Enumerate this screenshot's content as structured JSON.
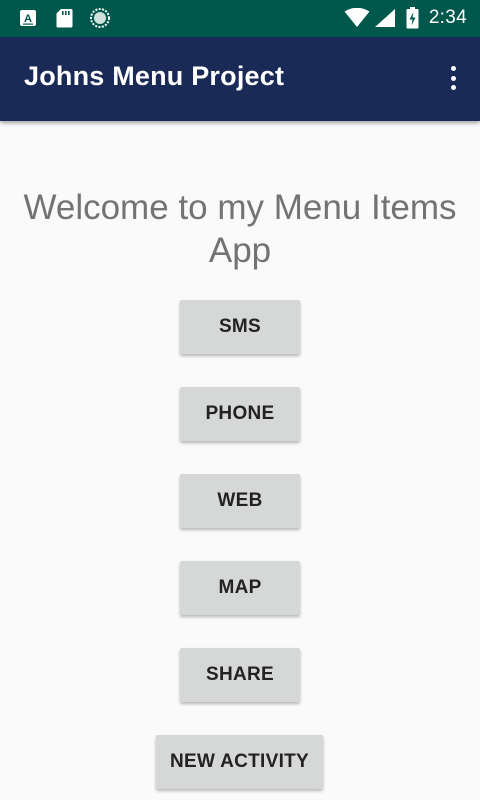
{
  "status_bar": {
    "icons_left": [
      "a-notification-icon",
      "sd-card-icon",
      "sync-circle-icon"
    ],
    "icons_right": [
      "wifi-icon",
      "signal-icon",
      "battery-charging-icon"
    ],
    "time": "2:34",
    "color": "#00574b"
  },
  "app_bar": {
    "title": "Johns Menu Project",
    "color": "#1a2a56",
    "overflow_icon": "more-vert-icon"
  },
  "main": {
    "welcome_text": "Welcome to my Menu Items App",
    "buttons": [
      {
        "label": "SMS"
      },
      {
        "label": "PHONE"
      },
      {
        "label": "WEB"
      },
      {
        "label": "MAP"
      },
      {
        "label": "SHARE"
      },
      {
        "label": "NEW ACTIVITY"
      }
    ],
    "button_color": "#d6d7d7"
  }
}
